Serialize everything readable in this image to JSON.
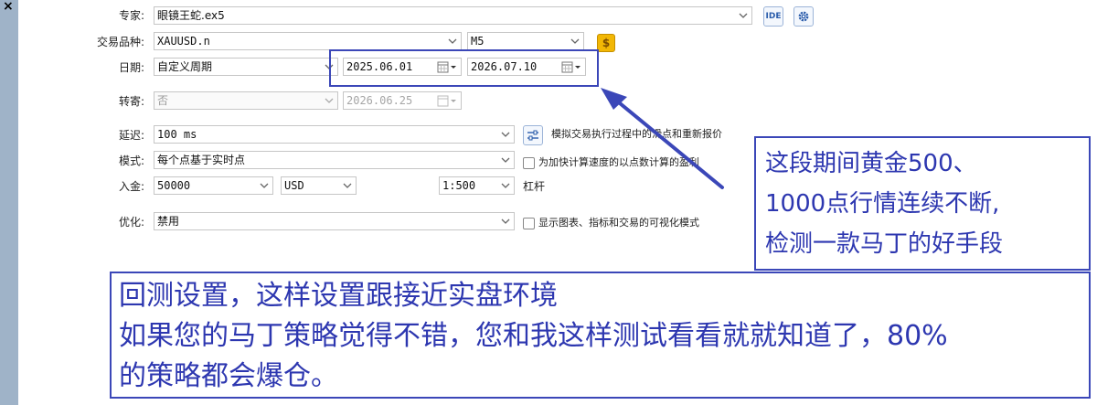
{
  "window": {
    "close_glyph": "×"
  },
  "expert": {
    "label": "专家:",
    "value": "眼镜王蛇.ex5",
    "ide_label": "IDE"
  },
  "symbol": {
    "label": "交易品种:",
    "value": "XAUUSD.n",
    "timeframe": "M5",
    "dollar_glyph": "$"
  },
  "date": {
    "label": "日期:",
    "mode": "自定义周期",
    "from": "2025.06.01",
    "to": "2026.07.10"
  },
  "forward": {
    "label": "转寄:",
    "value": "否",
    "date": "2026.06.25"
  },
  "delay": {
    "label": "延迟:",
    "value": "100 ms",
    "note": "模拟交易执行过程中的滑点和重新报价"
  },
  "model": {
    "label": "模式:",
    "value": "每个点基于实时点",
    "checkbox_label": "为加快计算速度的以点数计算的盈利",
    "checked": false
  },
  "deposit": {
    "label": "入金:",
    "amount": "50000",
    "currency": "USD",
    "leverage": "1:500",
    "leverage_label": "杠杆"
  },
  "optimization": {
    "label": "优化:",
    "value": "禁用",
    "checkbox_label": "显示图表、指标和交易的可视化模式",
    "checked": false
  },
  "annotation_right": {
    "lines": [
      "这段期间黄金500、",
      "1000点行情连续不断,",
      "检测一款马丁的好手段"
    ]
  },
  "annotation_bottom": {
    "lines": [
      "回测设置，这样设置跟接近实盘环境",
      "如果您的马丁策略觉得不错，您和我这样测试看看就就知道了，80%",
      "的策略都会爆仓。"
    ]
  },
  "colors": {
    "annotation": "#3b47b8",
    "side_strip": "#9fb3c8"
  }
}
